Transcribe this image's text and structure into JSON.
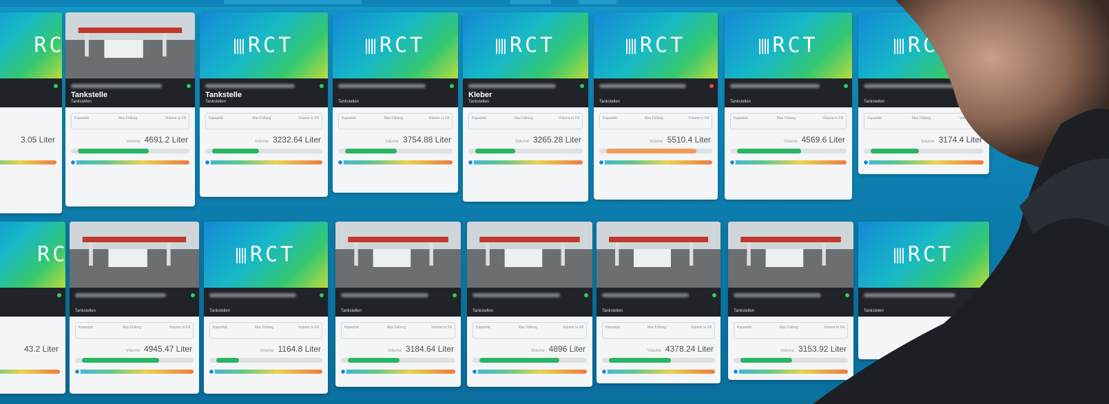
{
  "brand": {
    "logo_text": "RCT",
    "colors": {
      "accent_green": "#2ecc5f",
      "status_red": "#e74c3c",
      "band": "#202327"
    }
  },
  "cards": [
    {
      "id": "c1",
      "name": "Tankstelle",
      "category": "Tankstellen",
      "hero": "photo",
      "status": "#2ecc5f",
      "volume": "4691.2 Liter"
    },
    {
      "id": "c2",
      "name": "Tankstelle",
      "category": "Tankstellen",
      "hero": "logo",
      "status": "#2ecc5f",
      "volume": "3232.64 Liter"
    },
    {
      "id": "c3",
      "name": "",
      "category": "Tankstellen",
      "hero": "logo",
      "status": "#2ecc5f",
      "volume": "3754.88 Liter"
    },
    {
      "id": "c4",
      "name": "Kleber",
      "category": "Tankstellen",
      "hero": "logo",
      "status": "#2ecc5f",
      "volume": "3265.28 Liter"
    },
    {
      "id": "c5",
      "name": "",
      "category": "Tankstellen",
      "hero": "logo",
      "status": "#e74c3c",
      "volume": "5510.4 Liter"
    },
    {
      "id": "c6",
      "name": "",
      "category": "Tankstellen",
      "hero": "logo",
      "status": "#2ecc5f",
      "volume": "4569.6 Liter"
    },
    {
      "id": "c7",
      "name": "",
      "category": "Tankstellen",
      "hero": "logo",
      "status": "#2ecc5f",
      "volume": "3174.4 Liter"
    },
    {
      "id": "c8",
      "name": "",
      "category": "Tankstellen",
      "hero": "photo",
      "status": "#2ecc5f",
      "volume": "4945.47 Liter"
    },
    {
      "id": "c9",
      "name": "",
      "category": "Tankstellen",
      "hero": "logo",
      "status": "#2ecc5f",
      "volume": "1164.8 Liter"
    },
    {
      "id": "c10",
      "name": "",
      "category": "Tankstellen",
      "hero": "photo",
      "status": "#2ecc5f",
      "volume": "3184.64 Liter"
    },
    {
      "id": "c11",
      "name": "",
      "category": "Tankstellen",
      "hero": "photo",
      "status": "#2ecc5f",
      "volume": "4896 Liter"
    },
    {
      "id": "c12",
      "name": "",
      "category": "Tankstellen",
      "hero": "photo",
      "status": "#2ecc5f",
      "volume": "4378.24 Liter"
    },
    {
      "id": "c13",
      "name": "",
      "category": "Tankstellen",
      "hero": "photo",
      "status": "#2ecc5f",
      "volume": "3153.92 Liter"
    },
    {
      "id": "c14",
      "name": "",
      "category": "Tankstelen",
      "hero": "logo",
      "status": "#2ecc5f",
      "volume": ""
    }
  ],
  "edge_cards": {
    "top_left_volume": "3.05 Liter",
    "bottom_left_volume": "43.2 Liter"
  },
  "labels": {
    "kapazitat": "Kapazität",
    "max_fullung": "Max Füllung",
    "volume_to_fill": "Volume to Fill",
    "volume": "Volume"
  }
}
